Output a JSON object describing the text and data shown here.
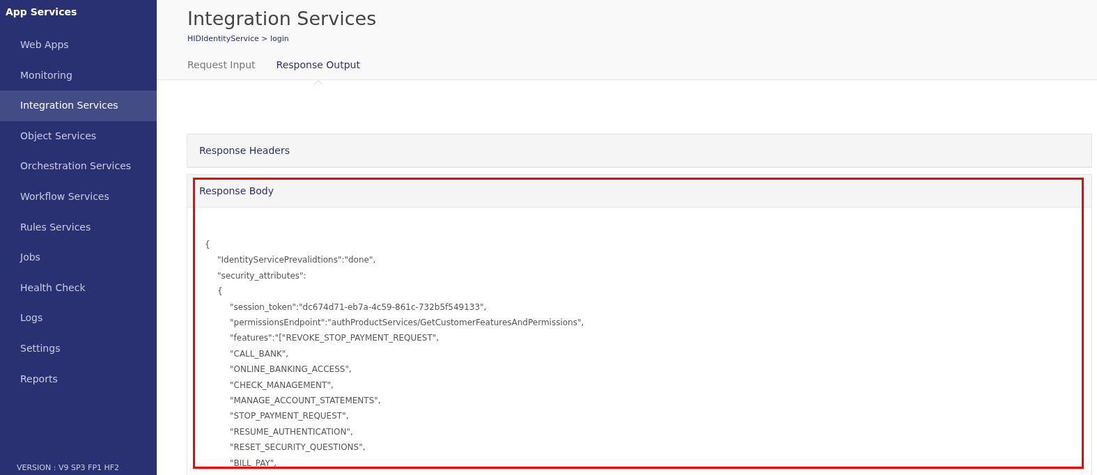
{
  "sidebar": {
    "title": "App Services",
    "items": [
      {
        "label": "Web Apps",
        "selected": false
      },
      {
        "label": "Monitoring",
        "selected": false
      },
      {
        "label": "Integration Services",
        "selected": true
      },
      {
        "label": "Object Services",
        "selected": false
      },
      {
        "label": "Orchestration Services",
        "selected": false
      },
      {
        "label": "Workflow Services",
        "selected": false
      },
      {
        "label": "Rules Services",
        "selected": false
      },
      {
        "label": "Jobs",
        "selected": false
      },
      {
        "label": "Health Check",
        "selected": false
      },
      {
        "label": "Logs",
        "selected": false
      },
      {
        "label": "Settings",
        "selected": false
      },
      {
        "label": "Reports",
        "selected": false
      }
    ],
    "version": "VERSION : V9 SP3 FP1 HF2"
  },
  "header": {
    "title": "Integration Services",
    "breadcrumb": "HIDIdentityService > login"
  },
  "tabs": [
    {
      "label": "Request Input",
      "selected": false
    },
    {
      "label": "Response Output",
      "selected": true
    }
  ],
  "panels": [
    {
      "title": "Response Headers",
      "highlighted": false
    },
    {
      "title": "Response Body",
      "highlighted": true,
      "body_lines": [
        {
          "text": "{",
          "children": [
            {
              "text": "\"IdentityServicePrevalidtions\":\"done\","
            },
            {
              "text": "\"security_attributes\":"
            },
            {
              "text": "{",
              "children": [
                {
                  "text": "\"session_token\":\"dc674d71-eb7a-4c59-861c-732b5f549133\","
                },
                {
                  "text": "\"permissionsEndpoint\":\"authProductServices/GetCustomerFeaturesAndPermissions\","
                },
                {
                  "text": "\"features\":\"[\"REVOKE_STOP_PAYMENT_REQUEST\","
                },
                {
                  "text": "\"CALL_BANK\","
                },
                {
                  "text": "\"ONLINE_BANKING_ACCESS\","
                },
                {
                  "text": "\"CHECK_MANAGEMENT\","
                },
                {
                  "text": "\"MANAGE_ACCOUNT_STATEMENTS\","
                },
                {
                  "text": "\"STOP_PAYMENT_REQUEST\","
                },
                {
                  "text": "\"RESUME_AUTHENTICATION\","
                },
                {
                  "text": "\"RESET_SECURITY_QUESTIONS\","
                },
                {
                  "text": "\"BILL_PAY\","
                }
              ]
            }
          ]
        }
      ]
    }
  ]
}
